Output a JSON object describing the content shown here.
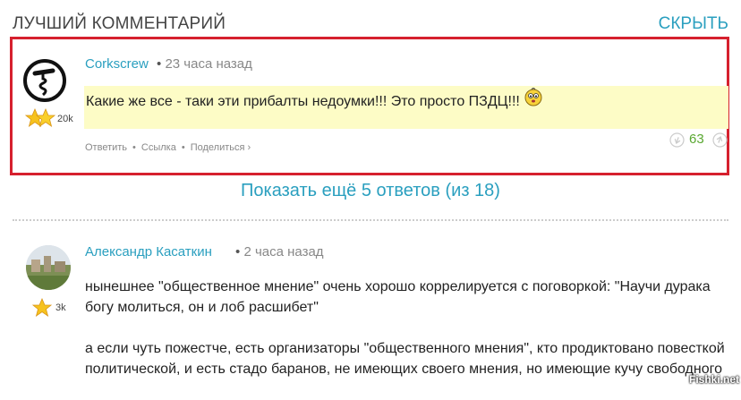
{
  "header": {
    "title": "ЛУЧШИЙ КОММЕНТАРИЙ",
    "hide_label": "СКРЫТЬ"
  },
  "best_comment": {
    "author": "Corkscrew",
    "separator": "•",
    "time": "23 часа назад",
    "rating": "20k",
    "text": "Какие же все - таки эти прибалты недоумки!!! Это просто ПЗДЦ!!!",
    "actions": [
      "Ответить",
      "Ссылка",
      "Поделиться ›"
    ],
    "votes": "63",
    "colors": {
      "highlight": "#fdfcc6",
      "border": "#d6202e",
      "votes": "#5aa832"
    }
  },
  "show_more": "Показать ещё 5 ответов (из 18)",
  "comment2": {
    "author": "Александр Касаткин",
    "separator": "•",
    "time": "2 часа назад",
    "rating": "3k",
    "paragraphs": [
      "нынешнее \"общественное мнение\" очень хорошо коррелируется с поговоркой: \"Научи дурака богу молиться, он и лоб расшибет\"",
      "а если чуть пожестче, есть организаторы \"общественного мнения\", кто продиктовано повесткой политической, и есть стадо баранов, не имеющих своего мнения, но имеющие кучу свободного"
    ]
  },
  "watermark": "Fishki.net",
  "accent_color": "#2a9fbf"
}
